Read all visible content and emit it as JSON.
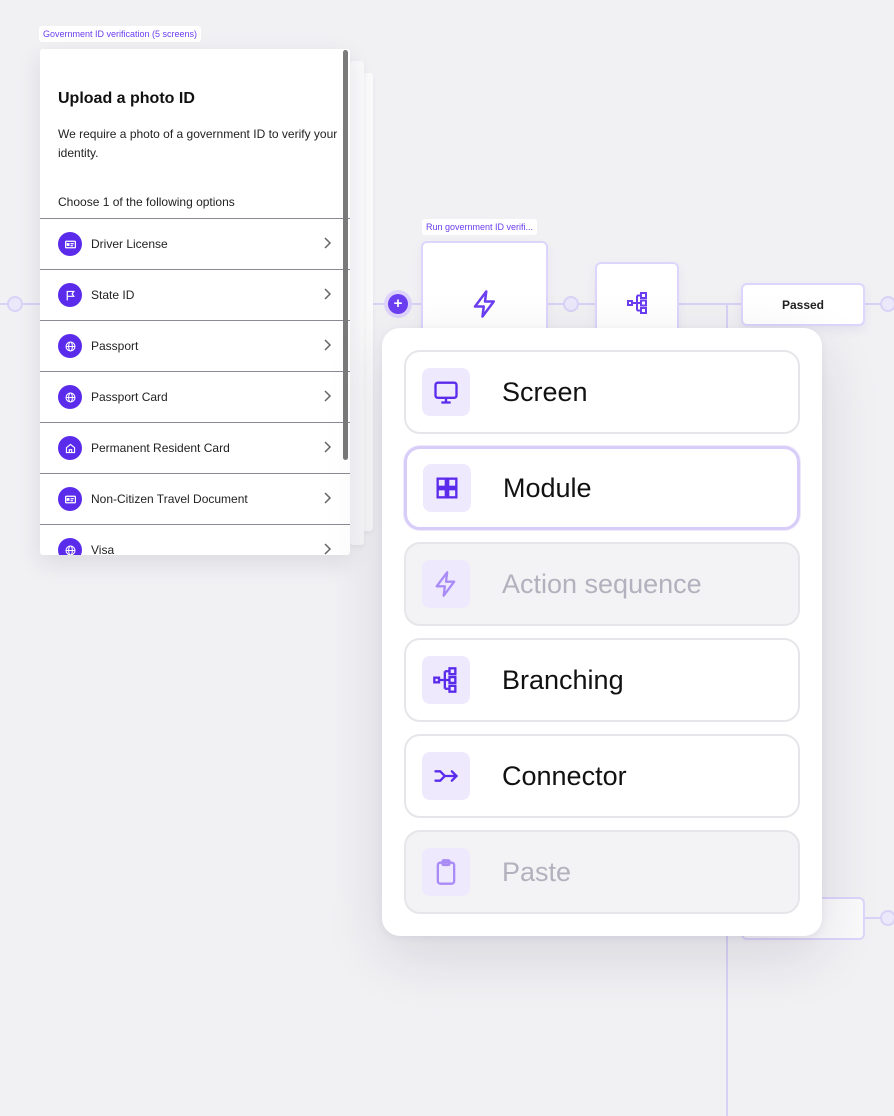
{
  "canvas": {
    "colors": {
      "accent": "#5b2bec",
      "accent_light": "#efe9fd",
      "connector": "#d9d2f7",
      "background": "#f1f1f4"
    }
  },
  "screen_group": {
    "label": "Government ID verification (5 screens)",
    "screen": {
      "title": "Upload a photo ID",
      "description": "We require a photo of a government ID to verify your identity.",
      "prompt": "Choose 1 of the following options",
      "options": [
        {
          "label": "Driver License",
          "icon": "id-card-icon"
        },
        {
          "label": "State ID",
          "icon": "flag-icon"
        },
        {
          "label": "Passport",
          "icon": "globe-icon"
        },
        {
          "label": "Passport Card",
          "icon": "globe-icon"
        },
        {
          "label": "Permanent Resident Card",
          "icon": "home-icon"
        },
        {
          "label": "Non-Citizen Travel Document",
          "icon": "id-card-icon"
        },
        {
          "label": "Visa",
          "icon": "globe-icon"
        }
      ]
    }
  },
  "flow": {
    "action_node_label": "Run government ID verifi...",
    "action_node_icon": "lightning-icon",
    "branch_node_icon": "branching-icon",
    "passed_label": "Passed",
    "add_button": "+"
  },
  "add_menu": {
    "items": [
      {
        "label": "Screen",
        "icon": "monitor-icon",
        "state": "normal"
      },
      {
        "label": "Module",
        "icon": "grid-icon",
        "state": "selected"
      },
      {
        "label": "Action sequence",
        "icon": "lightning-icon",
        "state": "disabled"
      },
      {
        "label": "Branching",
        "icon": "branching-icon",
        "state": "normal"
      },
      {
        "label": "Connector",
        "icon": "connector-icon",
        "state": "normal"
      },
      {
        "label": "Paste",
        "icon": "clipboard-icon",
        "state": "disabled"
      }
    ]
  }
}
